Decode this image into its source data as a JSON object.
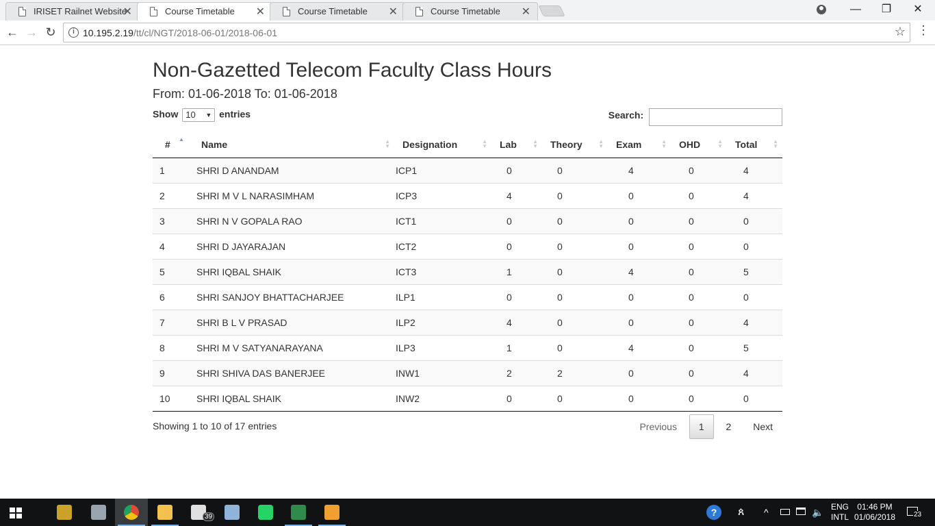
{
  "browser": {
    "tabs": [
      {
        "label": "IRISET Railnet Website",
        "active": false
      },
      {
        "label": "Course Timetable",
        "active": true
      },
      {
        "label": "Course Timetable",
        "active": false
      },
      {
        "label": "Course Timetable",
        "active": false
      }
    ],
    "url_host": "10.195.2.19",
    "url_path": "/tt/cl/NGT/2018-06-01/2018-06-01",
    "close_glyph": "✕",
    "min_glyph": "—",
    "restore_glyph": "❐",
    "back_glyph": "←",
    "forward_glyph": "→",
    "reload_glyph": "↻",
    "info_glyph": "i",
    "star_glyph": "☆",
    "menu_glyph": "⋮"
  },
  "page": {
    "title": "Non-Gazetted Telecom Faculty Class Hours",
    "range": "From: 01-06-2018 To: 01-06-2018",
    "show_label": "Show",
    "entries_label": "entries",
    "page_length": "10",
    "caret": "▼",
    "search_label": "Search:",
    "search_value": ""
  },
  "table": {
    "columns": [
      "#",
      "Name",
      "Designation",
      "Lab",
      "Theory",
      "Exam",
      "OHD",
      "Total"
    ],
    "rows": [
      [
        "1",
        "SHRI D ANANDAM",
        "ICP1",
        "0",
        "0",
        "4",
        "0",
        "4"
      ],
      [
        "2",
        "SHRI M V L NARASIMHAM",
        "ICP3",
        "4",
        "0",
        "0",
        "0",
        "4"
      ],
      [
        "3",
        "SHRI N V GOPALA RAO",
        "ICT1",
        "0",
        "0",
        "0",
        "0",
        "0"
      ],
      [
        "4",
        "SHRI D JAYARAJAN",
        "ICT2",
        "0",
        "0",
        "0",
        "0",
        "0"
      ],
      [
        "5",
        "SHRI IQBAL SHAIK",
        "ICT3",
        "1",
        "0",
        "4",
        "0",
        "5"
      ],
      [
        "6",
        "SHRI SANJOY BHATTACHARJEE",
        "ILP1",
        "0",
        "0",
        "0",
        "0",
        "0"
      ],
      [
        "7",
        "SHRI B L V PRASAD",
        "ILP2",
        "4",
        "0",
        "0",
        "0",
        "4"
      ],
      [
        "8",
        "SHRI M V SATYANARAYANA",
        "ILP3",
        "1",
        "0",
        "4",
        "0",
        "5"
      ],
      [
        "9",
        "SHRI SHIVA DAS BANERJEE",
        "INW1",
        "2",
        "2",
        "0",
        "0",
        "4"
      ],
      [
        "10",
        "SHRI IQBAL SHAIK",
        "INW2",
        "0",
        "0",
        "0",
        "0",
        "0"
      ]
    ],
    "sort_column": "#",
    "sort_dir": "asc"
  },
  "footer": {
    "info": "Showing 1 to 10 of 17 entries",
    "previous": "Previous",
    "pages": [
      "1",
      "2"
    ],
    "current_page": "1",
    "next": "Next"
  },
  "taskbar": {
    "apps": [
      {
        "name": "winrar-icon",
        "color": "#c9a227"
      },
      {
        "name": "paint-icon",
        "color": "#9aa4ae"
      },
      {
        "name": "chrome-icon",
        "color": "#dd4b39"
      },
      {
        "name": "file-explorer-icon",
        "color": "#f2c14e"
      },
      {
        "name": "mail-icon",
        "color": "#e0e0e0"
      },
      {
        "name": "virtualbox-icon",
        "color": "#8fb3d9"
      },
      {
        "name": "whatsapp-icon",
        "color": "#25d366"
      },
      {
        "name": "excel-icon",
        "color": "#2f8a4b"
      },
      {
        "name": "media-player-icon",
        "color": "#f0a030"
      }
    ],
    "mail_badge": "39",
    "lang_top": "ENG",
    "lang_bottom": "INTL",
    "time": "01:46 PM",
    "date": "01/06/2018",
    "notifications": "23"
  }
}
